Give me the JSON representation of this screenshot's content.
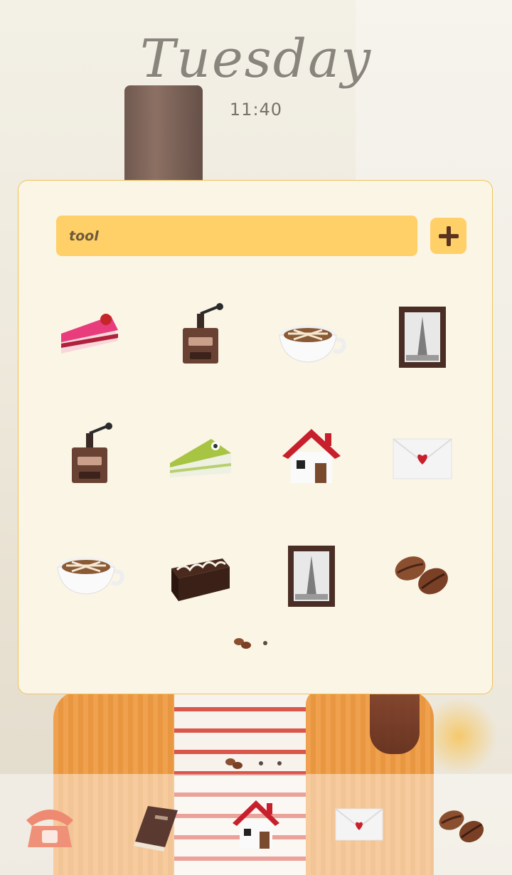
{
  "clock": {
    "day": "Tuesday",
    "time": "11:40"
  },
  "search": {
    "value": "tool"
  },
  "grid_icons": [
    "cake-slice-pink-icon",
    "coffee-grinder-icon",
    "latte-cup-icon",
    "eiffel-frame-icon",
    "coffee-grinder-icon",
    "cake-slice-green-icon",
    "home-icon",
    "letter-heart-icon",
    "latte-cup-icon",
    "brownie-icon",
    "eiffel-frame-icon",
    "coffee-beans-icon"
  ],
  "dock": [
    "phone-icon",
    "book-icon",
    "home-icon",
    "letter-heart-icon",
    "coffee-beans-icon"
  ],
  "colors": {
    "accent": "#ffcf68",
    "panel": "#fbf5e6",
    "panel_border": "#f0c35a"
  }
}
